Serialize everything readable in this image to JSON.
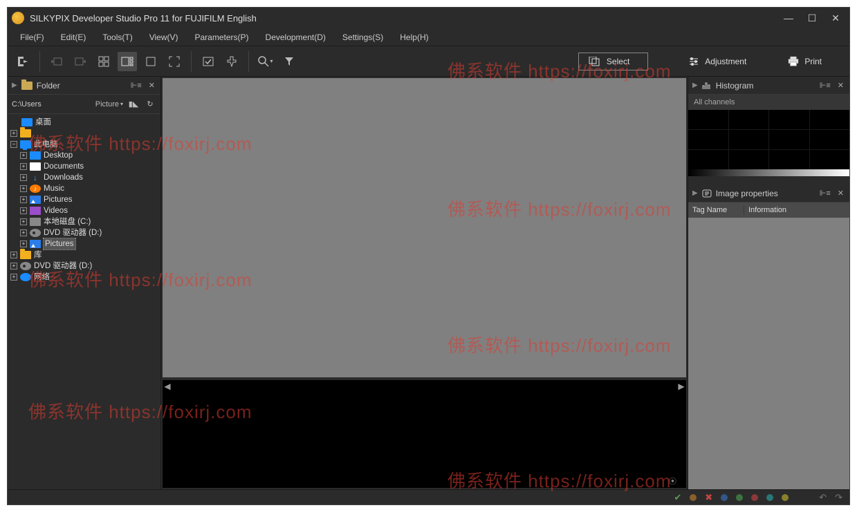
{
  "window": {
    "title": "SILKYPIX Developer Studio Pro 11 for FUJIFILM English"
  },
  "menu": {
    "file": "File(F)",
    "edit": "Edit(E)",
    "tools": "Tools(T)",
    "view": "View(V)",
    "parameters": "Parameters(P)",
    "development": "Development(D)",
    "settings": "Settings(S)",
    "help": "Help(H)"
  },
  "toolbar": {
    "select": "Select",
    "adjustment": "Adjustment",
    "print": "Print"
  },
  "left": {
    "panel_title": "Folder",
    "path": "C:\\Users",
    "picture_selector": "Picture",
    "tree": {
      "desktop": "桌面",
      "this_pc": "此电脑",
      "desktop2": "Desktop",
      "documents": "Documents",
      "downloads": "Downloads",
      "music": "Music",
      "pictures": "Pictures",
      "videos": "Videos",
      "local_disk": "本地磁盘 (C:)",
      "dvd": "DVD 驱动器 (D:)",
      "pictures2": "Pictures",
      "library": "库",
      "dvd2": "DVD 驱动器 (D:)",
      "network": "网络"
    }
  },
  "right": {
    "histogram_title": "Histogram",
    "channels": "All channels",
    "props_title": "Image properties",
    "col_tag": "Tag Name",
    "col_info": "Information"
  },
  "watermark": "佛系软件 https://foxirj.com"
}
